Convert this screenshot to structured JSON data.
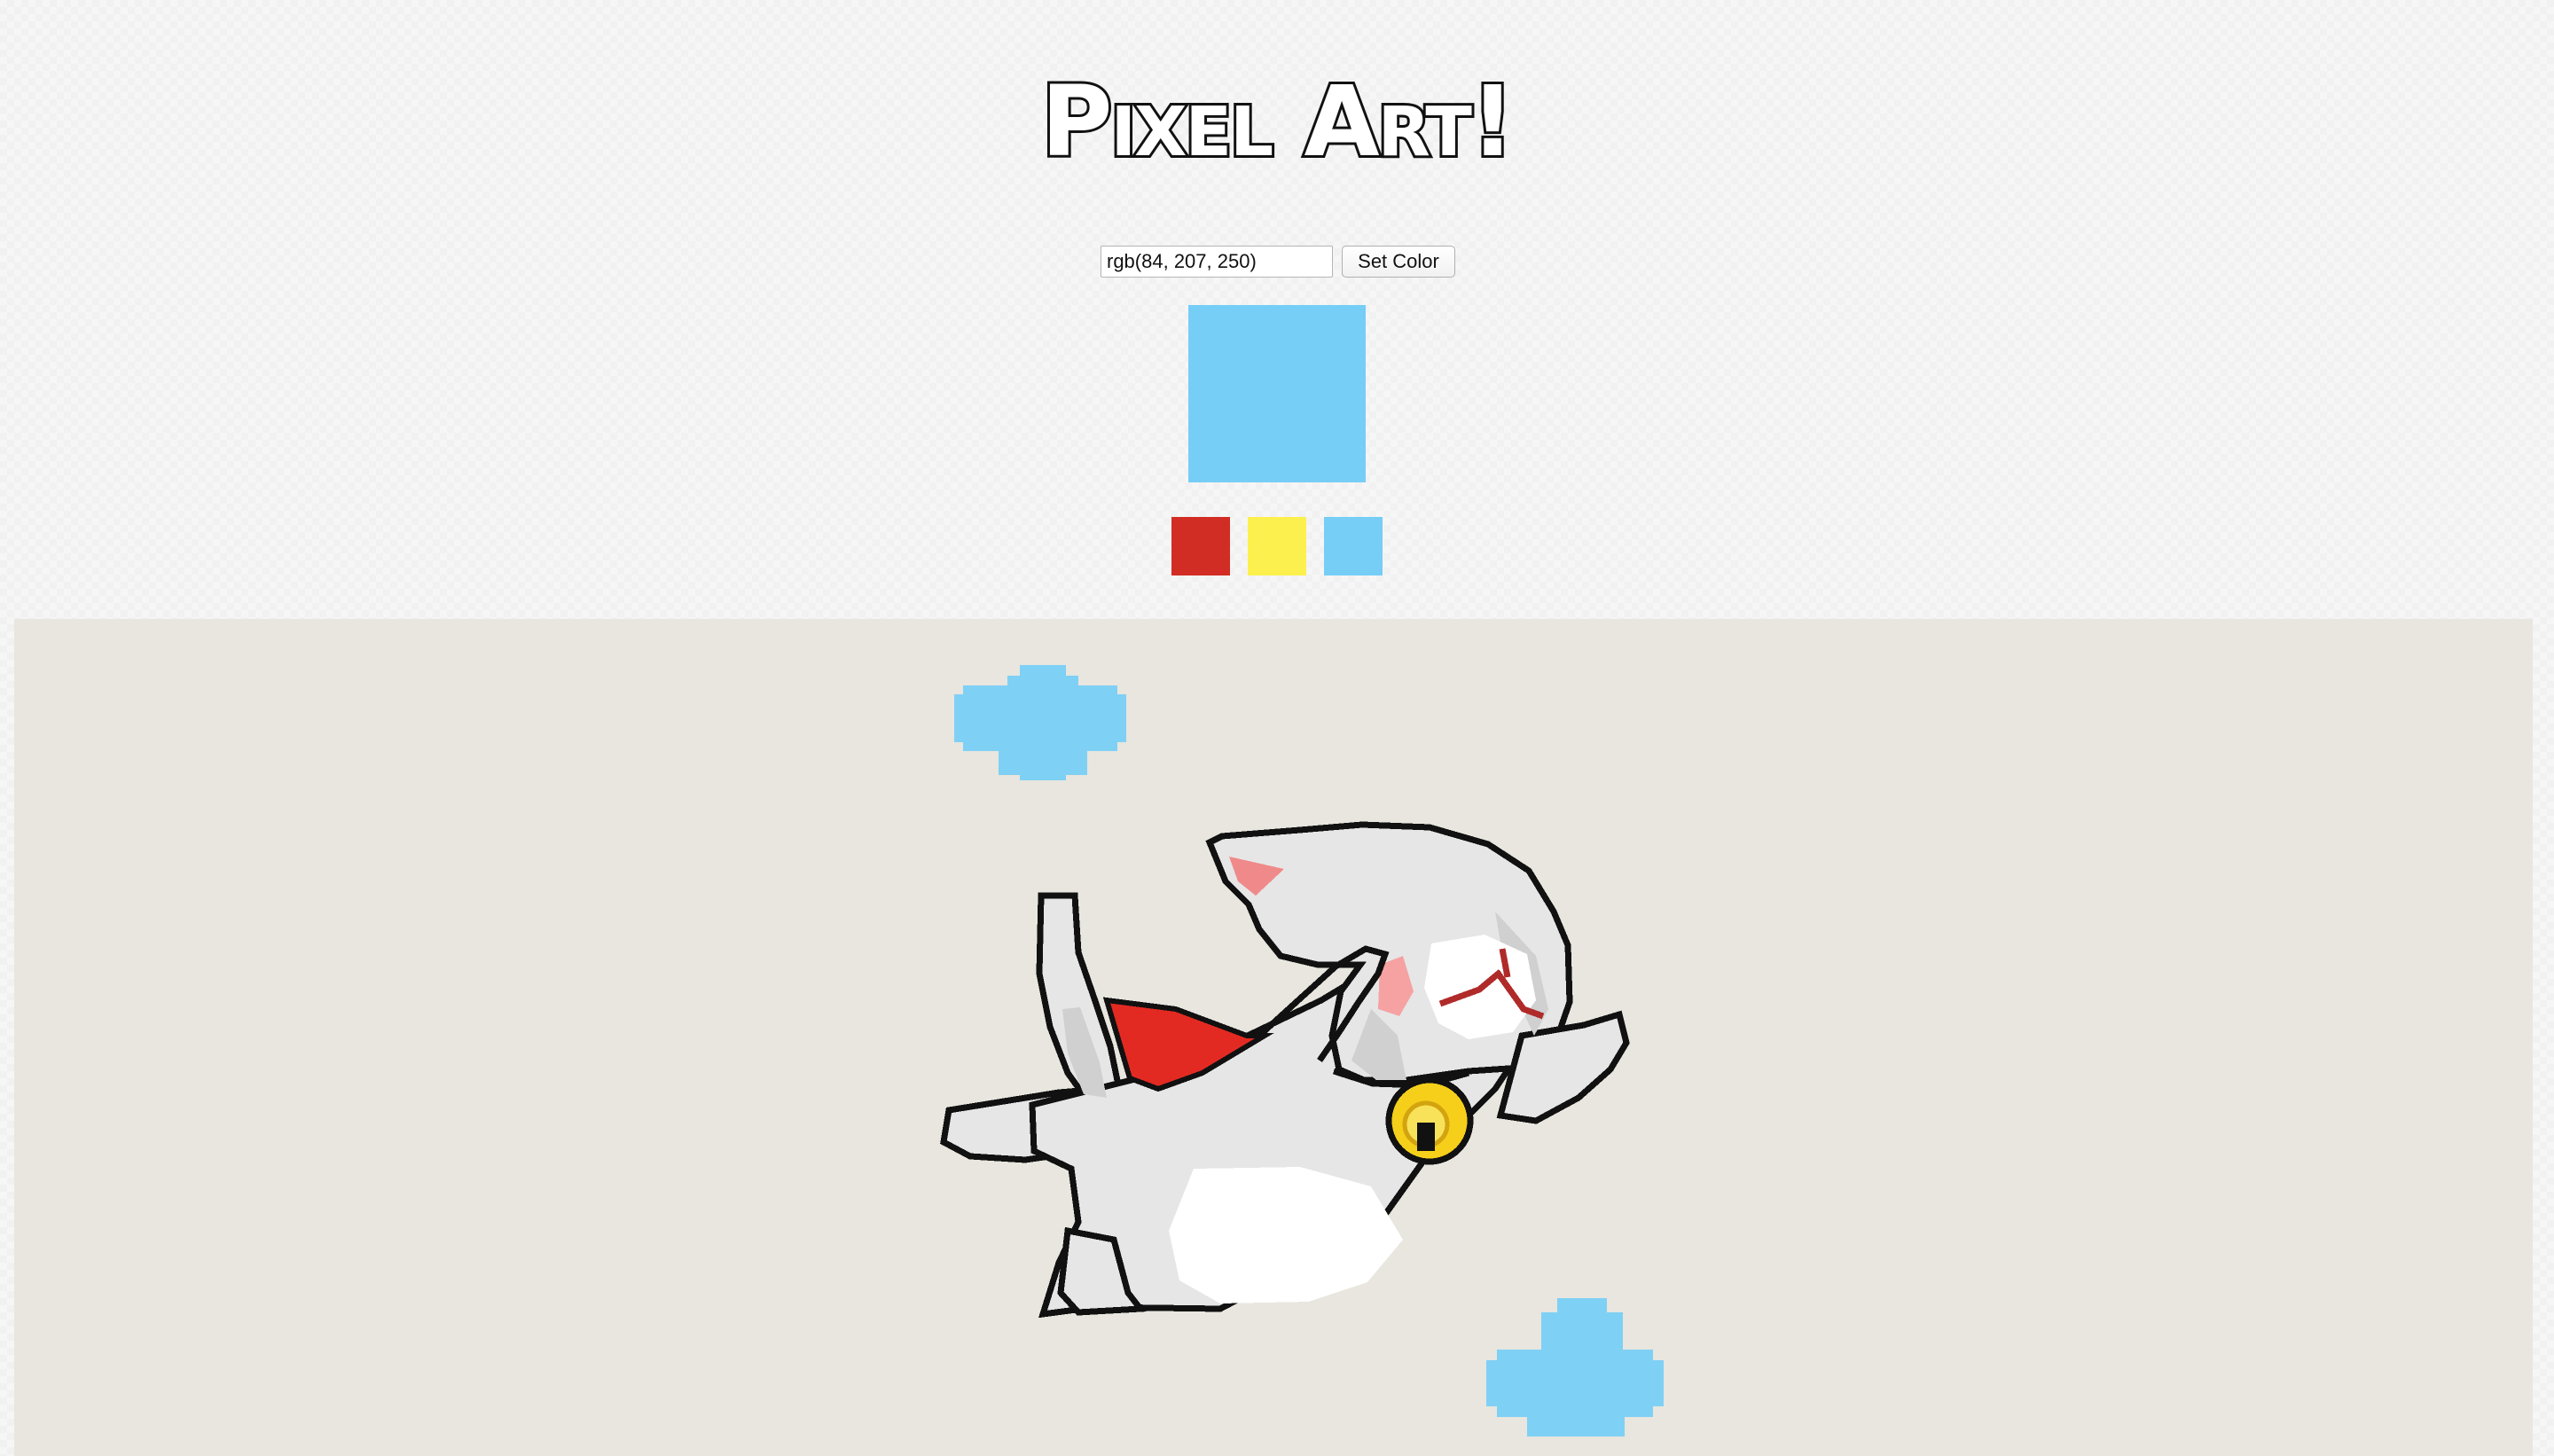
{
  "title": "Pixel Art!",
  "color_picker": {
    "input_value": "rgb(84, 207, 250)",
    "button_label": "Set Color",
    "current_color": "#76cdf6"
  },
  "palette": [
    {
      "name": "red",
      "color": "#d22d24"
    },
    {
      "name": "yellow",
      "color": "#fcf04f"
    },
    {
      "name": "blue",
      "color": "#76cdf6"
    }
  ],
  "canvas": {
    "background": "#e8e6de",
    "drawing": "pixel-art-flying-white-cat"
  },
  "colors": {
    "outline": "#111111",
    "cat_fill": "#e6e6e6",
    "cat_shade": "#d0d0d0",
    "belly": "#ffffff",
    "ear_pink": "#f08a8a",
    "blush": "#f6a2a2",
    "cape_red": "#e32a22",
    "bell_yellow": "#f5cf1a",
    "cloud_blue": "#7fd0f5"
  }
}
